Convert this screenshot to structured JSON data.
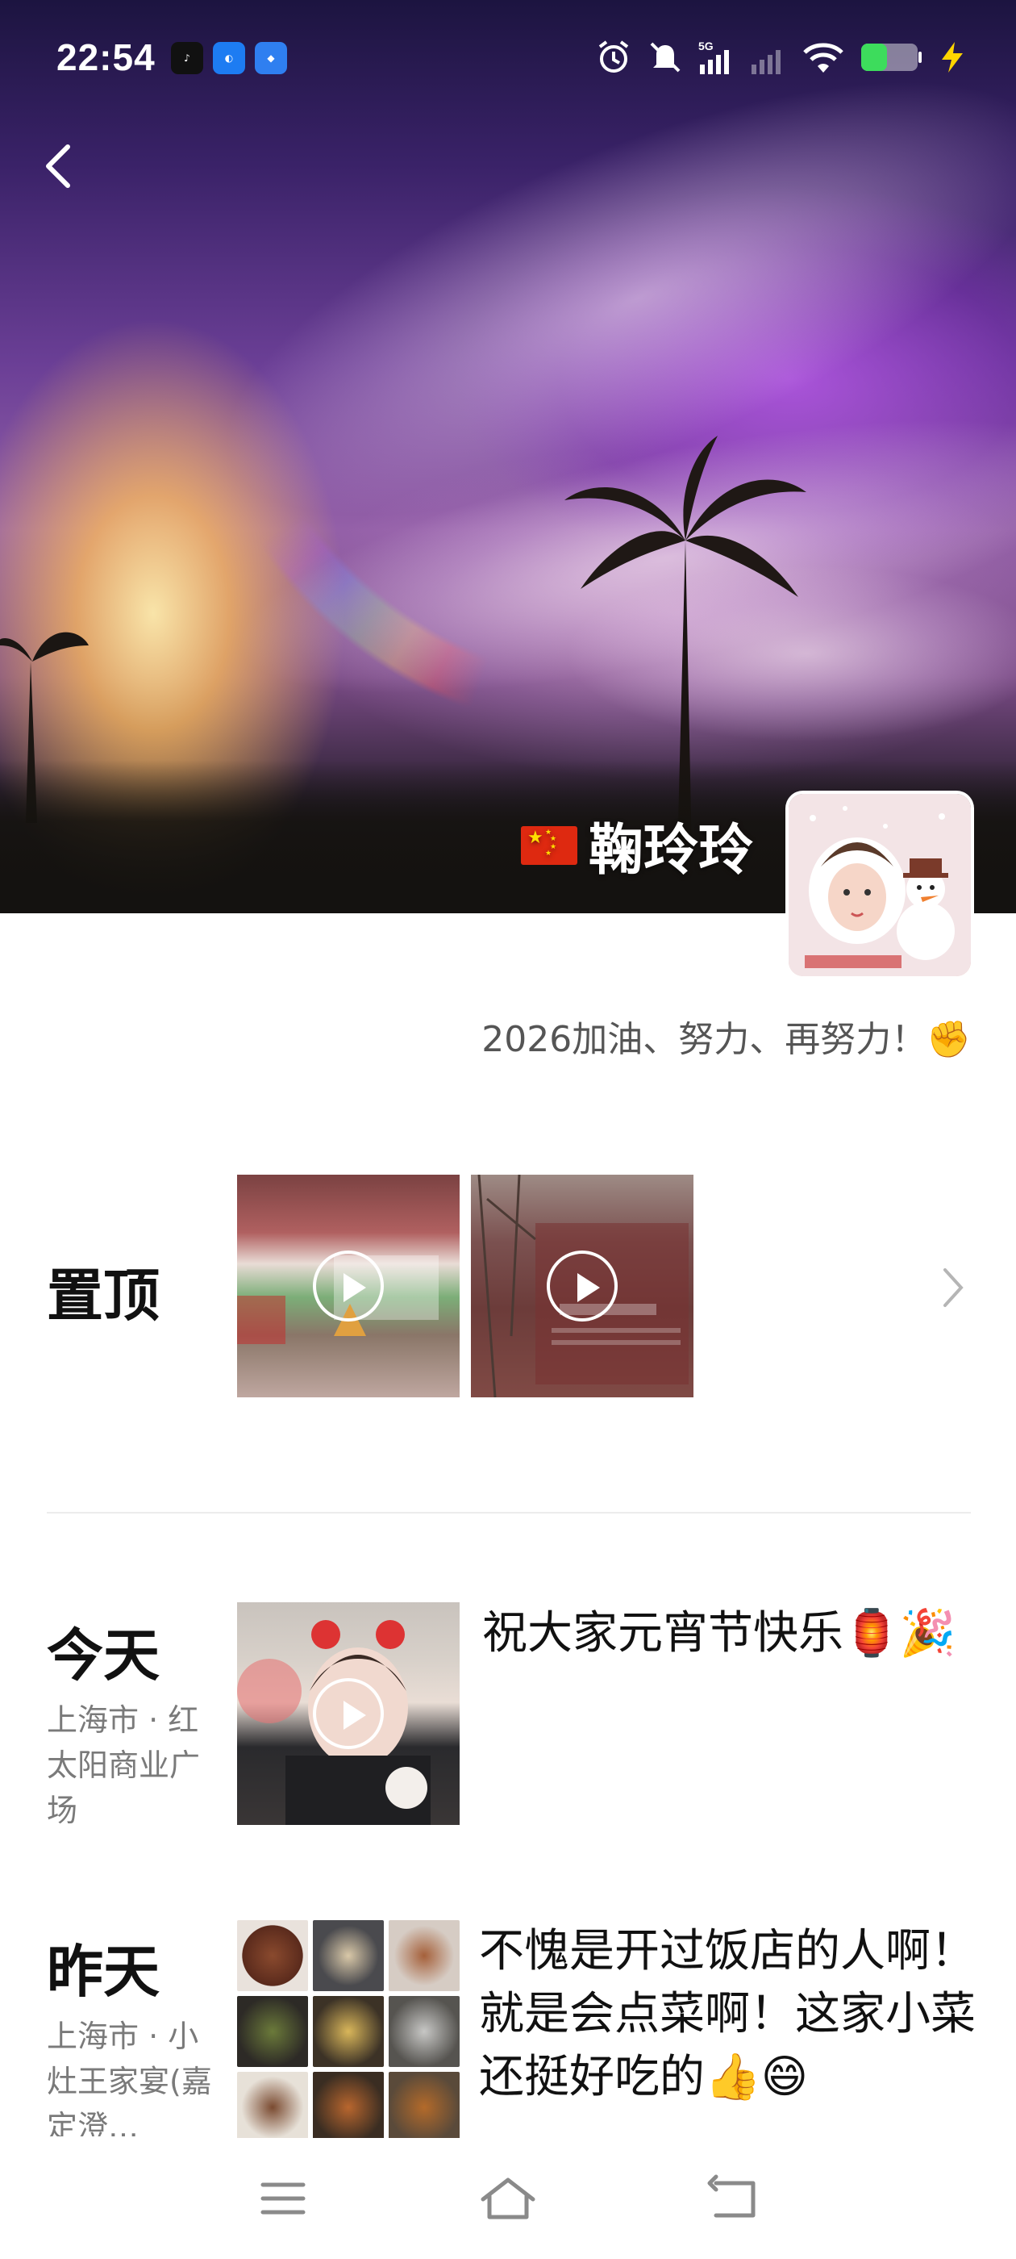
{
  "status_bar": {
    "time": "22:54",
    "app_icons": [
      "tiktok-icon",
      "browser-icon",
      "car-app-icon"
    ],
    "right_icons": [
      "alarm-icon",
      "mute-icon",
      "5g-signal-icon",
      "wifi-icon",
      "battery-icon",
      "charging-icon"
    ],
    "network": "5G"
  },
  "profile": {
    "nickname": "鞠玲玲",
    "flag": "china-flag-icon",
    "signature": "2026加油、努力、再努力！✊"
  },
  "pinned": {
    "label": "置顶",
    "items": [
      {
        "type": "video",
        "icon": "play-icon"
      },
      {
        "type": "video",
        "icon": "play-icon"
      }
    ]
  },
  "posts": [
    {
      "day": "今天",
      "location": "上海市 · 红太阳商业广场",
      "media": "video",
      "text": "祝大家元宵节快乐🏮🎉"
    },
    {
      "day": "昨天",
      "location": "上海市 · 小灶王家宴(嘉定澄…",
      "media": "photo-grid-9",
      "text": "不愧是开过饭店的人啊！就是会点菜啊！这家小菜还挺好吃的👍😄"
    }
  ],
  "nav_bar": [
    "menu-icon",
    "home-icon",
    "back-icon"
  ],
  "colors": {
    "accent_purple": "#6b3f96",
    "text_primary": "#111111",
    "text_secondary": "#7a7a7a",
    "battery_green": "#3ddc5c",
    "charge_yellow": "#ffd400"
  }
}
